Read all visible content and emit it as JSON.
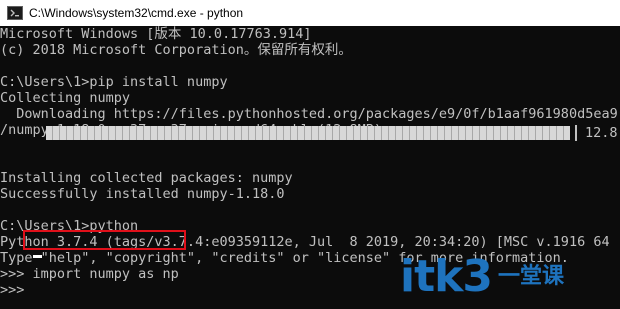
{
  "window": {
    "title": "C:\\Windows\\system32\\cmd.exe - python",
    "icon": "cmd-icon"
  },
  "console": {
    "lines": [
      "Microsoft Windows [版本 10.0.17763.914]",
      "(c) 2018 Microsoft Corporation。保留所有权利。",
      "",
      "C:\\Users\\1>pip install numpy",
      "Collecting numpy",
      "  Downloading https://files.pythonhosted.org/packages/e9/0f/b1aaf961980d5ea9",
      "/numpy-1.18.0-cp37-cp37m-win_amd64.whl (12.8MB)",
      "",
      "Installing collected packages: numpy",
      "Successfully installed numpy-1.18.0",
      "",
      "C:\\Users\\1>python",
      "Python 3.7.4 (tags/v3.7.4:e09359112e, Jul  8 2019, 20:34:20) [MSC v.1916 64",
      "Type \"help\", \"copyright\", \"credits\" or \"license\" for more information.",
      ">>> import numpy as np",
      ">>> "
    ],
    "progress": {
      "fraction": 1.0,
      "size_text": "12.8"
    },
    "highlighted_command": "import numpy as np",
    "highlight_color": "#e0101a"
  },
  "watermark": {
    "main": "itk3",
    "side": "一堂课",
    "color": "#1e73be"
  }
}
